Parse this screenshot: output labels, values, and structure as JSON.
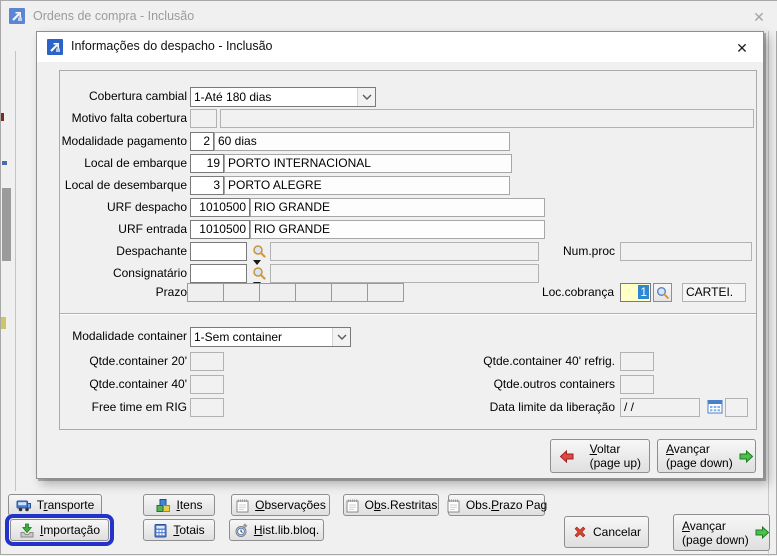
{
  "colors": {
    "window_bg": "#f0f0f0",
    "titlebar_active_bg": "#ffffff",
    "inactive_title_text": "#9b9b9b",
    "focus_outline_blue": "#2333c9",
    "highlight_field_bg": "#ffffc6",
    "selection_bg": "#2f86d2",
    "green_arrow": "#4cc04c",
    "red_arrow": "#e04848",
    "cancel_red": "#dd4936"
  },
  "glyphs": {
    "close": "✕"
  },
  "outer": {
    "title": "Ordens de compra - Inclusão"
  },
  "dialog": {
    "title": "Informações do despacho - Inclusão",
    "cobertura": {
      "label": "Cobertura cambial",
      "value": "1-Até 180 dias"
    },
    "motivo": {
      "label": "Motivo falta cobertura",
      "code": "",
      "desc": ""
    },
    "pagamento": {
      "label": "Modalidade pagamento",
      "code": "2",
      "desc": "60 dias"
    },
    "embarque": {
      "label": "Local de embarque",
      "code": "19",
      "desc": "PORTO INTERNACIONAL"
    },
    "desembarque": {
      "label": "Local de desembarque",
      "code": "3",
      "desc": "PORTO ALEGRE"
    },
    "urf_despacho": {
      "label": "URF despacho",
      "code": "1010500",
      "desc": "RIO GRANDE"
    },
    "urf_entrada": {
      "label": "URF entrada",
      "code": "1010500",
      "desc": "RIO GRANDE"
    },
    "despachante": {
      "label": "Despachante",
      "code": "",
      "desc": ""
    },
    "consignatario": {
      "label": "Consignatário",
      "code": "",
      "desc": ""
    },
    "num_proc": {
      "label": "Num.proc",
      "value": ""
    },
    "prazo": {
      "label": "Prazo"
    },
    "loc_cobranca": {
      "label": "Loc.cobrança",
      "code": "1",
      "desc": "CARTEI."
    },
    "container": {
      "label": "Modalidade container",
      "value": "1-Sem container"
    },
    "qtde20": {
      "label": "Qtde.container 20'",
      "value": ""
    },
    "qtde40": {
      "label": "Qtde.container 40'",
      "value": ""
    },
    "freetime": {
      "label": "Free time em RIG",
      "value": ""
    },
    "qtde40r": {
      "label": "Qtde.container 40' refrig.",
      "value": ""
    },
    "qtdeoutros": {
      "label": "Qtde.outros containers",
      "value": ""
    },
    "datalimite": {
      "label": "Data limite da liberação",
      "value": "/ /",
      "extra": ""
    },
    "voltar": {
      "key": "V",
      "post": "oltar",
      "line2": "(page up)"
    },
    "avancar": {
      "key": "A",
      "post": "vançar",
      "line2": "(page down)"
    }
  },
  "bottom": {
    "transporte": {
      "pre": "T",
      "key": "r",
      "post": "ansporte"
    },
    "itens": {
      "pre": "",
      "key": "I",
      "post": "tens"
    },
    "observacoes": {
      "pre": "",
      "key": "O",
      "post": "bservações"
    },
    "obs_restritas": {
      "pre": "O",
      "key": "b",
      "post": "s.Restritas"
    },
    "obs_prazo": {
      "pre": "Obs.",
      "key": "P",
      "post": "razo Pag"
    },
    "importacao": {
      "pre": "",
      "key": "I",
      "post": "mportação"
    },
    "totais": {
      "pre": "",
      "key": "T",
      "post": "otais"
    },
    "hist": {
      "pre": "",
      "key": "H",
      "post": "ist.lib.bloq."
    },
    "cancelar": {
      "label": "Cancelar"
    },
    "avancar": {
      "key": "A",
      "post": "vançar",
      "line2": "(page down)"
    }
  }
}
